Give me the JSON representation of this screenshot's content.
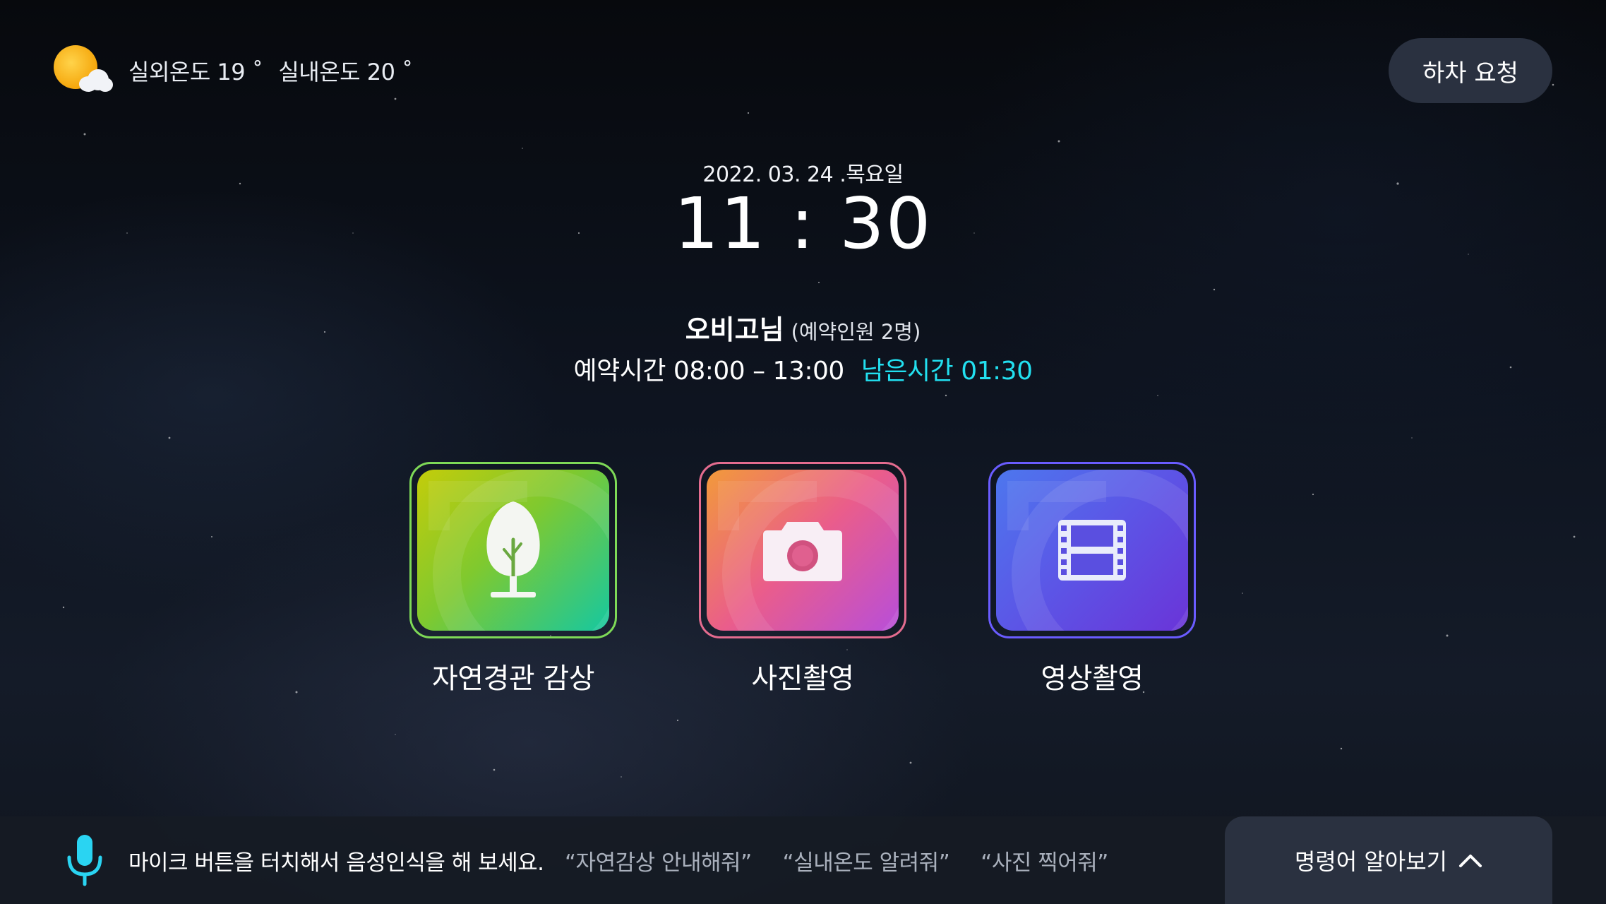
{
  "header": {
    "weather_icon": "sun-cloud-icon",
    "outdoor_temp": "실외온도 19 ˚",
    "indoor_temp": "실내온도 20 ˚",
    "drop_off_button": "하차 요청"
  },
  "clock": {
    "date": "2022. 03. 24 .목요일",
    "time": "11 : 30"
  },
  "reservation": {
    "customer_name": "오비고님",
    "party": "(예약인원 2명)",
    "time_range": "예약시간 08:00 – 13:00",
    "remaining": "남은시간 01:30",
    "remaining_color": "#22e0f0"
  },
  "tiles": [
    {
      "label": "자연경관 감상",
      "icon": "tree-icon",
      "color": "#7ed957"
    },
    {
      "label": "사진촬영",
      "icon": "camera-icon",
      "color": "#e46c8f"
    },
    {
      "label": "영상촬영",
      "icon": "film-icon",
      "color": "#6a5cff"
    }
  ],
  "voice_bar": {
    "mic_icon": "mic-icon",
    "hint": "마이크 버튼을 터치해서 음성인식을 해 보세요.",
    "examples": [
      "“자연감상 안내해줘”",
      "“실내온도 알려줘”",
      "“사진 찍어줘”"
    ],
    "commands_button": "명령어 알아보기"
  }
}
